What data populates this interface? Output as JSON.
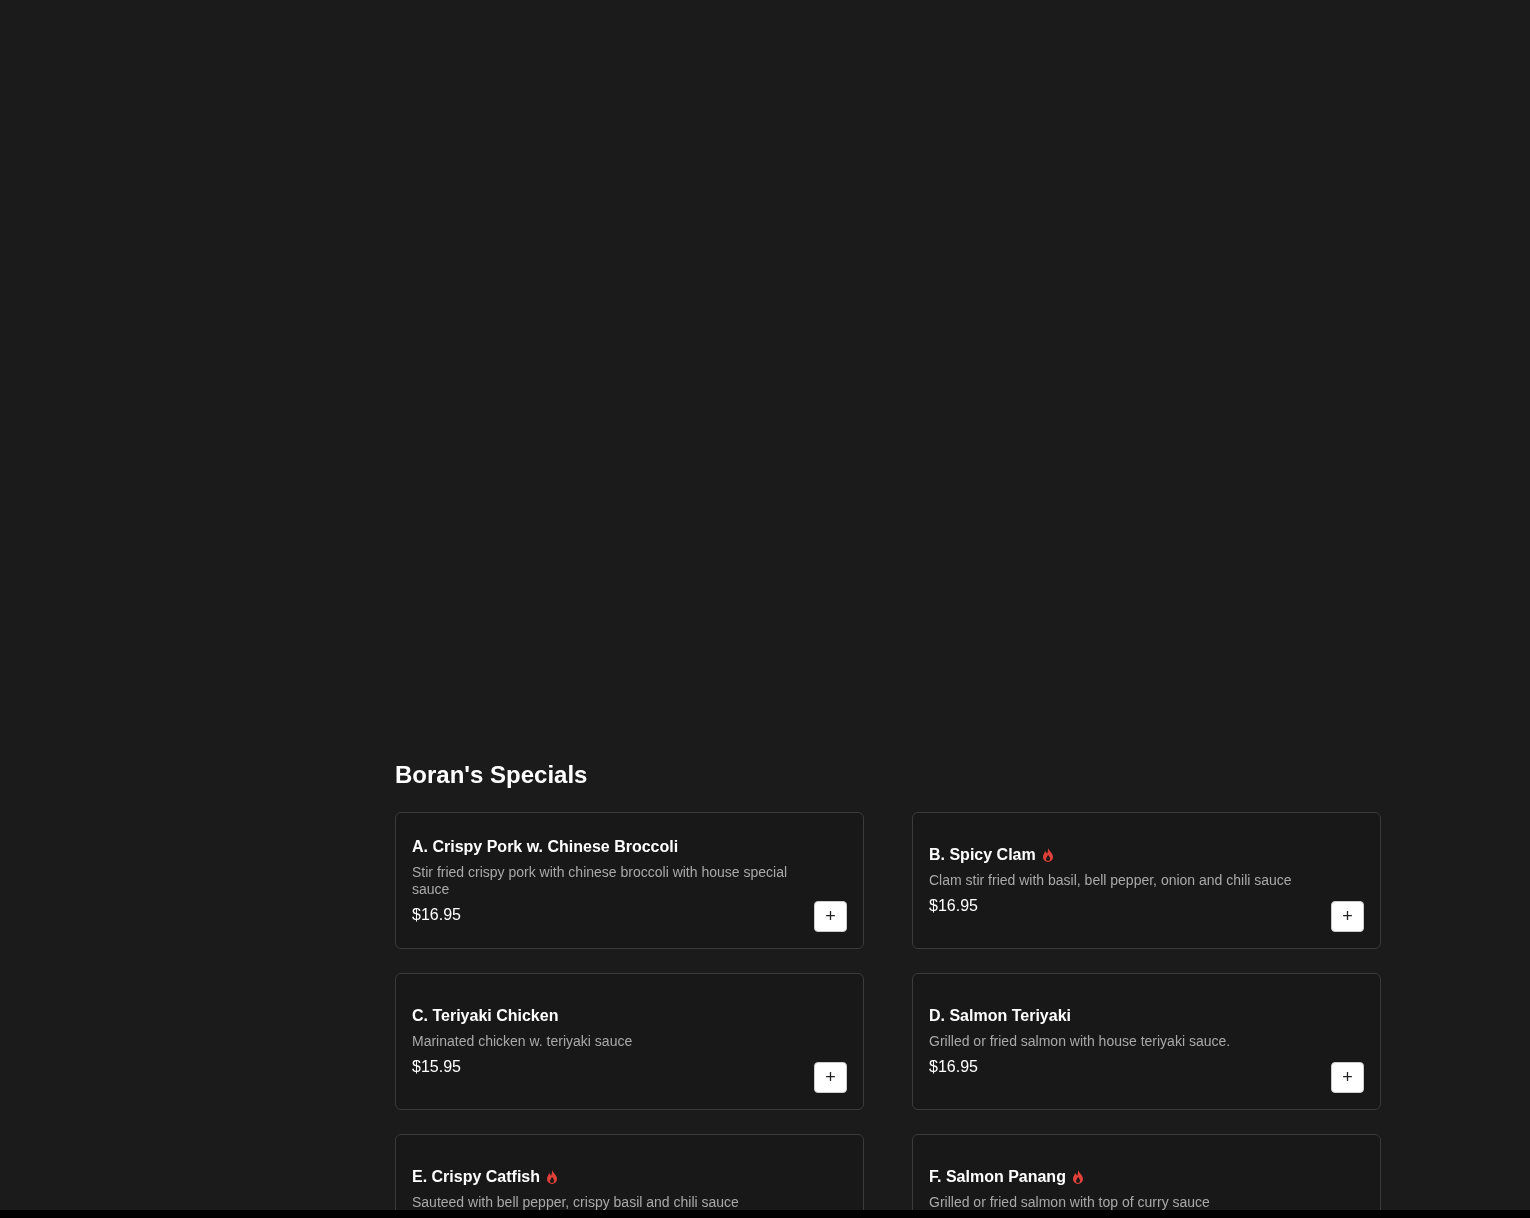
{
  "section": {
    "title": "Boran's Specials",
    "items": [
      {
        "title": "A. Crispy Pork w. Chinese Broccoli",
        "spicy": false,
        "description": "Stir fried crispy pork with chinese broccoli with house special sauce",
        "price": "$16.95",
        "button": "+"
      },
      {
        "title": "B. Spicy Clam",
        "spicy": true,
        "description": "Clam stir fried with basil, bell pepper, onion and chili sauce",
        "price": "$16.95",
        "button": "+"
      },
      {
        "title": "C. Teriyaki Chicken",
        "spicy": false,
        "description": "Marinated chicken w. teriyaki sauce",
        "price": "$15.95",
        "button": "+"
      },
      {
        "title": "D. Salmon Teriyaki",
        "spicy": false,
        "description": "Grilled or fried salmon with house teriyaki sauce.",
        "price": "$16.95",
        "button": "+"
      },
      {
        "title": "E. Crispy Catfish",
        "spicy": true,
        "description": "Sauteed with bell pepper, crispy basil and chili sauce"
      },
      {
        "title": "F. Salmon Panang",
        "spicy": true,
        "description": "Grilled or fried salmon with top of curry sauce"
      }
    ]
  }
}
